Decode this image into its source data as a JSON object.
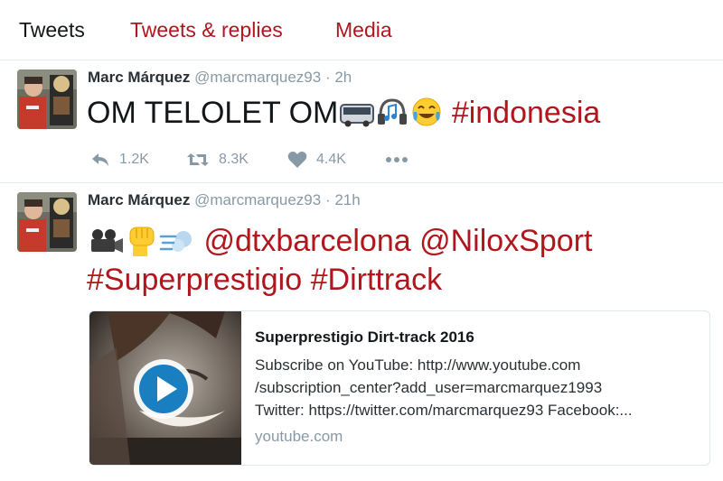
{
  "tabs": [
    {
      "label": "Tweets"
    },
    {
      "label": "Tweets & replies"
    },
    {
      "label": "Media"
    }
  ],
  "tweets": [
    {
      "name": "Marc Márquez",
      "handle": "@marcmarquez93",
      "separator": "·",
      "time": "2h",
      "text": "OM TELOLET OM",
      "emojis": [
        "bus-icon",
        "headphones-icon",
        "tears-of-joy-icon"
      ],
      "hashtag": "#indonesia",
      "replies": "1.2K",
      "retweets": "8.3K",
      "likes": "4.4K"
    },
    {
      "name": "Marc Márquez",
      "handle": "@marcmarquez93",
      "separator": "·",
      "time": "21h",
      "emojis": [
        "movie-camera-icon",
        "raised-fist-icon",
        "dash-icon"
      ],
      "mention1": "@dtxbarcelona",
      "mention2": "@NiloxSport",
      "hashtag1": "#Superprestigio",
      "hashtag2": "#Dirttrack",
      "card": {
        "title": "Superprestigio Dirt-track 2016",
        "description": "Subscribe on YouTube: http://www.youtube.com\n/subscription_center?add_user=marcmarquez1993\nTwitter: https://twitter.com/marcmarquez93 Facebook:...",
        "domain": "youtube.com"
      }
    }
  ],
  "colors": {
    "accent": "#b0161c",
    "muted": "#8899a6",
    "border": "#e1e8ed"
  }
}
